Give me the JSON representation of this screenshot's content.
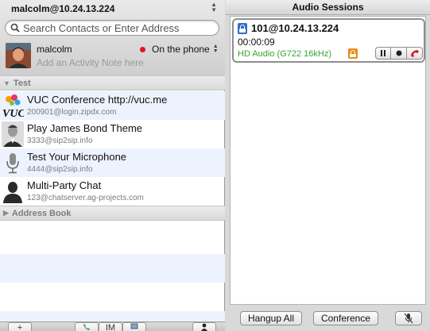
{
  "left": {
    "account": "malcolm@10.24.13.224",
    "search": {
      "placeholder": "Search Contacts or Enter Address"
    },
    "me": {
      "name": "malcolm",
      "status": "On the phone",
      "status_color": "#e0141a",
      "note_placeholder": "Add an Activity Note here"
    },
    "groups": [
      {
        "name": "Test",
        "expanded": true,
        "contacts": [
          {
            "name": "VUC Conference http://vuc.me",
            "address": "200901@login.zipdx.com",
            "icon": "vuc-logo-icon"
          },
          {
            "name": "Play James Bond Theme",
            "address": "3333@sip2sip.info",
            "icon": "person-photo-icon"
          },
          {
            "name": "Test Your Microphone",
            "address": "4444@sip2sip.info",
            "icon": "microphone-icon"
          },
          {
            "name": "Multi-Party Chat",
            "address": "123@chatserver.ag-projects.com",
            "icon": "person-silhouette-icon"
          }
        ]
      },
      {
        "name": "Address Book",
        "expanded": false,
        "contacts": []
      }
    ],
    "toolbar": {
      "add_label": "+",
      "im_label": "IM"
    }
  },
  "right": {
    "title": "Audio Sessions",
    "session": {
      "address": "101@10.24.13.224",
      "duration": "00:00:09",
      "codec": "HD Audio (G722 16kHz)",
      "codec_color": "#3aa32f",
      "secure": true
    },
    "buttons": {
      "hangup_all": "Hangup All",
      "conference": "Conference"
    }
  }
}
